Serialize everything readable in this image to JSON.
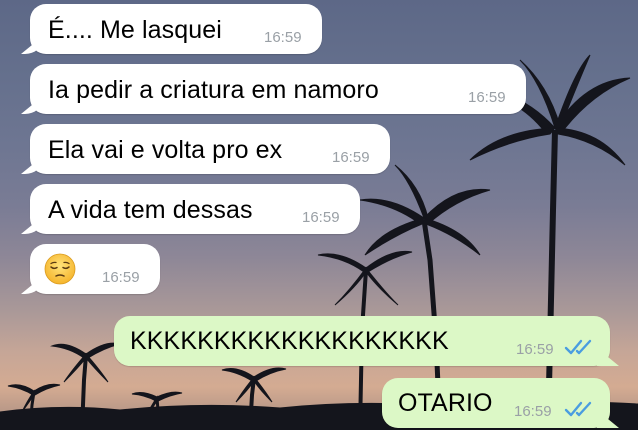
{
  "chat": {
    "messages": [
      {
        "direction": "incoming",
        "text": "É.... Me lasquei",
        "time": "16:59"
      },
      {
        "direction": "incoming",
        "text": "Ia pedir a criatura em namoro",
        "time": "16:59"
      },
      {
        "direction": "incoming",
        "text": "Ela vai e volta pro ex",
        "time": "16:59"
      },
      {
        "direction": "incoming",
        "text": "A vida tem dessas",
        "time": "16:59"
      },
      {
        "direction": "incoming",
        "emoji": "pensive-face",
        "time": "16:59"
      },
      {
        "direction": "outgoing",
        "text": "KKKKKKKKKKKKKKKKKKK",
        "time": "16:59",
        "status": "read-double-check"
      },
      {
        "direction": "outgoing",
        "text": "OTARIO",
        "time": "16:59",
        "status": "read-double-check"
      }
    ]
  },
  "colors": {
    "incoming_bubble": "#ffffff",
    "outgoing_bubble": "#dcf8c6",
    "timestamp": "#9aa0a6",
    "read_check": "#4a9de0"
  },
  "background": {
    "description_icon": "palm-tree-sunset-wallpaper"
  }
}
